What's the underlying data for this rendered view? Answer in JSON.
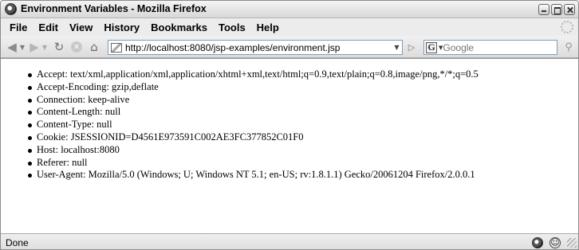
{
  "window": {
    "title": "Environment Variables - Mozilla Firefox"
  },
  "menu": {
    "items": [
      "File",
      "Edit",
      "View",
      "History",
      "Bookmarks",
      "Tools",
      "Help"
    ]
  },
  "navbar": {
    "url": "http://localhost:8080/jsp-examples/environment.jsp",
    "search_placeholder": "Google",
    "search_engine_letter": "G"
  },
  "content": {
    "entries": [
      "Accept: text/xml,application/xml,application/xhtml+xml,text/html;q=0.9,text/plain;q=0.8,image/png,*/*;q=0.5",
      "Accept-Encoding: gzip,deflate",
      "Connection: keep-alive",
      "Content-Length: null",
      "Content-Type: null",
      "Cookie: JSESSIONID=D4561E973591C002AE3FC377852C01F0",
      "Host: localhost:8080",
      "Referer: null",
      "User-Agent: Mozilla/5.0 (Windows; U; Windows NT 5.1; en-US; rv:1.8.1.1) Gecko/20061204 Firefox/2.0.0.1"
    ]
  },
  "status": {
    "text": "Done"
  }
}
